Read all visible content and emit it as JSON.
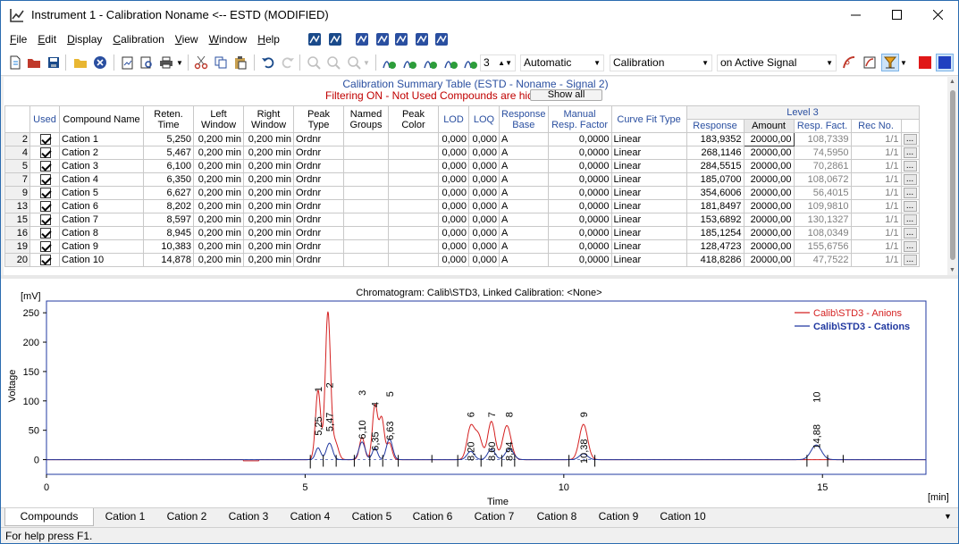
{
  "window": {
    "title": "Instrument 1 - Calibration Noname <-- ESTD (MODIFIED)"
  },
  "menu": [
    {
      "pre": "",
      "u": "F",
      "post": "ile"
    },
    {
      "pre": "",
      "u": "E",
      "post": "dit"
    },
    {
      "pre": "",
      "u": "D",
      "post": "isplay"
    },
    {
      "pre": "",
      "u": "C",
      "post": "alibration"
    },
    {
      "pre": "",
      "u": "V",
      "post": "iew"
    },
    {
      "pre": "",
      "u": "W",
      "post": "indow"
    },
    {
      "pre": "",
      "u": "H",
      "post": "elp"
    }
  ],
  "toolbar": {
    "spin_value": "3",
    "combo_mode": "Automatic",
    "combo_view": "Calibration",
    "combo_signal": "on Active Signal"
  },
  "table": {
    "title": "Calibration Summary Table (ESTD - Noname - Signal 2)",
    "filter_text": "Filtering ON - Not Used Compounds are hidden.",
    "show_all": "Show all",
    "headers": {
      "used": "Used",
      "name": "Compound Name",
      "ret": "Reten. Time",
      "left": "Left Window",
      "right": "Right Window",
      "peak_type": "Peak Type",
      "groups": "Named Groups",
      "color": "Peak Color",
      "lod": "LOD",
      "loq": "LOQ",
      "resp_base": "Response Base",
      "manual": "Manual Resp. Factor",
      "curve": "Curve Fit Type",
      "level": "Level 3",
      "response": "Response",
      "amount": "Amount",
      "resp_fact": "Resp. Fact.",
      "rec_no": "Rec No."
    },
    "rows": [
      {
        "no": "2",
        "name": "Cation 1",
        "ret": "5,250",
        "left": "0,200 min",
        "right": "0,200 min",
        "pt": "Ordnr",
        "lod": "0,000",
        "loq": "0,000",
        "base": "A",
        "manual": "0,0000",
        "curve": "Linear",
        "response": "183,9352",
        "amount": "20000,00",
        "rf": "108,7339",
        "rec": "1/1"
      },
      {
        "no": "4",
        "name": "Cation 2",
        "ret": "5,467",
        "left": "0,200 min",
        "right": "0,200 min",
        "pt": "Ordnr",
        "lod": "0,000",
        "loq": "0,000",
        "base": "A",
        "manual": "0,0000",
        "curve": "Linear",
        "response": "268,1146",
        "amount": "20000,00",
        "rf": "74,5950",
        "rec": "1/1"
      },
      {
        "no": "5",
        "name": "Cation 3",
        "ret": "6,100",
        "left": "0,200 min",
        "right": "0,200 min",
        "pt": "Ordnr",
        "lod": "0,000",
        "loq": "0,000",
        "base": "A",
        "manual": "0,0000",
        "curve": "Linear",
        "response": "284,5515",
        "amount": "20000,00",
        "rf": "70,2861",
        "rec": "1/1"
      },
      {
        "no": "7",
        "name": "Cation 4",
        "ret": "6,350",
        "left": "0,200 min",
        "right": "0,200 min",
        "pt": "Ordnr",
        "lod": "0,000",
        "loq": "0,000",
        "base": "A",
        "manual": "0,0000",
        "curve": "Linear",
        "response": "185,0700",
        "amount": "20000,00",
        "rf": "108,0672",
        "rec": "1/1"
      },
      {
        "no": "9",
        "name": "Cation 5",
        "ret": "6,627",
        "left": "0,200 min",
        "right": "0,200 min",
        "pt": "Ordnr",
        "lod": "0,000",
        "loq": "0,000",
        "base": "A",
        "manual": "0,0000",
        "curve": "Linear",
        "response": "354,6006",
        "amount": "20000,00",
        "rf": "56,4015",
        "rec": "1/1"
      },
      {
        "no": "13",
        "name": "Cation 6",
        "ret": "8,202",
        "left": "0,200 min",
        "right": "0,200 min",
        "pt": "Ordnr",
        "lod": "0,000",
        "loq": "0,000",
        "base": "A",
        "manual": "0,0000",
        "curve": "Linear",
        "response": "181,8497",
        "amount": "20000,00",
        "rf": "109,9810",
        "rec": "1/1"
      },
      {
        "no": "15",
        "name": "Cation 7",
        "ret": "8,597",
        "left": "0,200 min",
        "right": "0,200 min",
        "pt": "Ordnr",
        "lod": "0,000",
        "loq": "0,000",
        "base": "A",
        "manual": "0,0000",
        "curve": "Linear",
        "response": "153,6892",
        "amount": "20000,00",
        "rf": "130,1327",
        "rec": "1/1"
      },
      {
        "no": "16",
        "name": "Cation 8",
        "ret": "8,945",
        "left": "0,200 min",
        "right": "0,200 min",
        "pt": "Ordnr",
        "lod": "0,000",
        "loq": "0,000",
        "base": "A",
        "manual": "0,0000",
        "curve": "Linear",
        "response": "185,1254",
        "amount": "20000,00",
        "rf": "108,0349",
        "rec": "1/1"
      },
      {
        "no": "19",
        "name": "Cation 9",
        "ret": "10,383",
        "left": "0,200 min",
        "right": "0,200 min",
        "pt": "Ordnr",
        "lod": "0,000",
        "loq": "0,000",
        "base": "A",
        "manual": "0,0000",
        "curve": "Linear",
        "response": "128,4723",
        "amount": "20000,00",
        "rf": "155,6756",
        "rec": "1/1"
      },
      {
        "no": "20",
        "name": "Cation 10",
        "ret": "14,878",
        "left": "0,200 min",
        "right": "0,200 min",
        "pt": "Ordnr",
        "lod": "0,000",
        "loq": "0,000",
        "base": "A",
        "manual": "0,0000",
        "curve": "Linear",
        "response": "418,8286",
        "amount": "20000,00",
        "rf": "47,7522",
        "rec": "1/1"
      }
    ]
  },
  "chart_data": {
    "type": "line",
    "title": "Chromatogram: Calib\\STD3, Linked Calibration: <None>",
    "xlabel": "Time",
    "xunit": "[min]",
    "ylabel": "Voltage",
    "yunit": "[mV]",
    "xlim": [
      0,
      17
    ],
    "ylim": [
      -25,
      270
    ],
    "xticks": [
      0,
      5,
      10,
      15
    ],
    "yticks": [
      0,
      50,
      100,
      150,
      200,
      250
    ],
    "series": [
      {
        "name": "Calib\\STD3 - Anions",
        "color": "#d42020",
        "peaks": [
          [
            5.25,
            118,
            0.05
          ],
          [
            5.44,
            250,
            0.05
          ],
          [
            5.58,
            30,
            0.06
          ],
          [
            6.1,
            38,
            0.05
          ],
          [
            6.35,
            92,
            0.05
          ],
          [
            6.48,
            70,
            0.05
          ],
          [
            6.63,
            28,
            0.05
          ],
          [
            8.2,
            55,
            0.07
          ],
          [
            8.35,
            40,
            0.07
          ],
          [
            8.6,
            65,
            0.07
          ],
          [
            8.9,
            58,
            0.08
          ],
          [
            10.38,
            60,
            0.08
          ]
        ]
      },
      {
        "name": "Calib\\STD3 - Cations",
        "color": "#2038a0",
        "peaks": [
          [
            5.25,
            20,
            0.05
          ],
          [
            5.47,
            28,
            0.06
          ],
          [
            6.1,
            30,
            0.06
          ],
          [
            6.35,
            20,
            0.05
          ],
          [
            6.63,
            35,
            0.06
          ],
          [
            8.2,
            14,
            0.07
          ],
          [
            8.6,
            18,
            0.07
          ],
          [
            8.95,
            18,
            0.08
          ],
          [
            10.38,
            10,
            0.08
          ],
          [
            14.88,
            25,
            0.1
          ]
        ]
      }
    ],
    "peak_labels": [
      {
        "num": "1",
        "rt": "5,25",
        "t": 5.25,
        "y": 118
      },
      {
        "num": "2",
        "rt": "5,47",
        "t": 5.47,
        "y": 125
      },
      {
        "num": "3",
        "rt": "6,10",
        "t": 6.1,
        "y": 112
      },
      {
        "num": "4",
        "rt": "6,35",
        "t": 6.35,
        "y": 92
      },
      {
        "num": "5",
        "rt": "6,63",
        "t": 6.63,
        "y": 110
      },
      {
        "num": "6",
        "rt": "8,20",
        "t": 8.2,
        "y": 75
      },
      {
        "num": "7",
        "rt": "8,60",
        "t": 8.6,
        "y": 75
      },
      {
        "num": "8",
        "rt": "8,94",
        "t": 8.94,
        "y": 75
      },
      {
        "num": "9",
        "rt": "10,38",
        "t": 10.38,
        "y": 75
      },
      {
        "num": "10",
        "rt": "14,88",
        "t": 14.88,
        "y": 100
      }
    ]
  },
  "tabs": [
    "Compounds",
    "Cation 1",
    "Cation 2",
    "Cation 3",
    "Cation 4",
    "Cation 5",
    "Cation 6",
    "Cation 7",
    "Cation 8",
    "Cation 9",
    "Cation 10"
  ],
  "status": "For help press F1."
}
